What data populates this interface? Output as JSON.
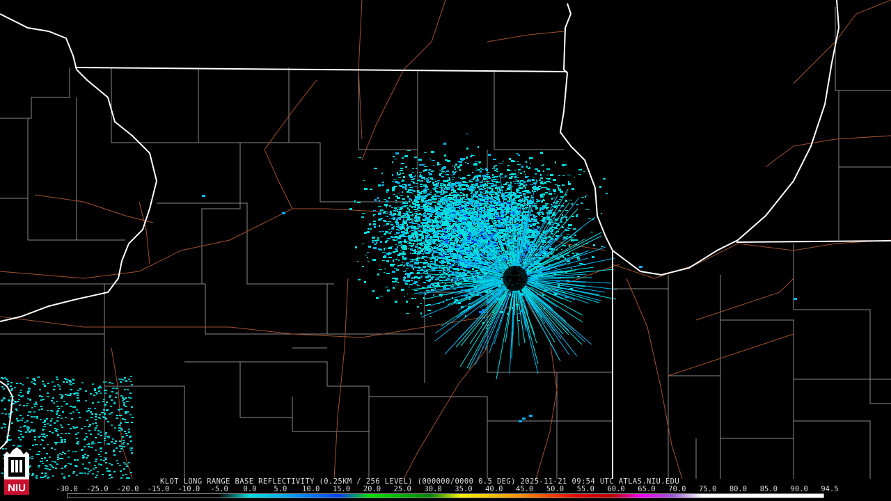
{
  "caption": "KLOT LONG RANGE BASE REFLECTIVITY (0.25KM / 256 LEVEL) (000000/0000 0.5 DEG) 2025-11-21 09:54 UTC  ATLAS.NIU.EDU",
  "logo": {
    "icon": "niu-logo-icon",
    "text": "NIU",
    "color": "#c8102e"
  },
  "scale": {
    "labels": [
      "-30.0",
      "-25.0",
      "-20.0",
      "-15.0",
      "-10.0",
      "-5.0",
      "0.0",
      "5.0",
      "10.0",
      "15.0",
      "20.0",
      "25.0",
      "30.0",
      "35.0",
      "40.0",
      "45.0",
      "50.0",
      "55.0",
      "60.0",
      "65.0",
      "70.0",
      "75.0",
      "80.0",
      "85.0",
      "90.0",
      "94.5"
    ],
    "colors": [
      "#000000",
      "#000000",
      "#000000",
      "#000000",
      "#000000",
      "#000000",
      "#00dede",
      "#04b4ec",
      "#0478f4",
      "#0440f0",
      "#04e404",
      "#04b404",
      "#048404",
      "#f8f400",
      "#f0c400",
      "#f89000",
      "#f44000",
      "#dc0000",
      "#c00000",
      "#f800f8",
      "#9858d4",
      "#ffffff",
      "#ffffff",
      "#ffffff",
      "#ffffff"
    ]
  },
  "colors": {
    "background": "#000000",
    "state_border": "#ffffff",
    "county_line": "#8a8a8a",
    "highway": "#a0522d",
    "echo_light": "#00dede",
    "echo_mid": "#04b4ec",
    "echo_heavy": "#0478f4",
    "echo_deep": "#0440f0"
  },
  "radar_site": "KLOT"
}
